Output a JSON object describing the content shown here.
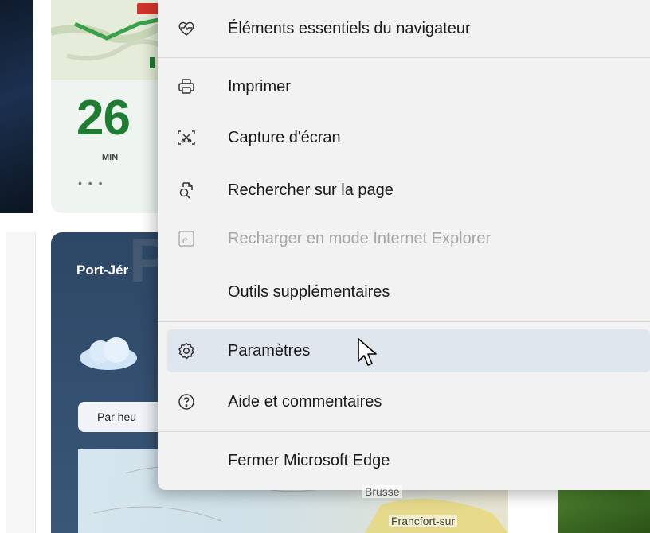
{
  "background": {
    "traffic": {
      "time": "26",
      "unit": "MIN",
      "dots": "• • •"
    },
    "weather": {
      "city": "Port-Jér",
      "period_button": "Par heu",
      "map_labels": {
        "bruxelles": "Brusse",
        "francfort": "Francfort-sur"
      }
    },
    "watermark": "PC ASTUCES"
  },
  "menu": {
    "items": [
      {
        "label": "Éléments essentiels du navigateur",
        "icon": "heart-pulse-icon",
        "enabled": true
      },
      {
        "label": "Imprimer",
        "icon": "printer-icon",
        "enabled": true
      },
      {
        "label": "Capture d'écran",
        "icon": "screenshot-icon",
        "enabled": true
      },
      {
        "label": "Rechercher sur la page",
        "icon": "find-on-page-icon",
        "enabled": true
      },
      {
        "label": "Recharger en mode Internet Explorer",
        "icon": "internet-explorer-icon",
        "enabled": false
      },
      {
        "label": "Outils supplémentaires",
        "icon": "",
        "enabled": true
      },
      {
        "label": "Paramètres",
        "icon": "gear-icon",
        "enabled": true,
        "hovered": true
      },
      {
        "label": "Aide et commentaires",
        "icon": "help-icon",
        "enabled": true
      },
      {
        "label": "Fermer Microsoft Edge",
        "icon": "",
        "enabled": true
      }
    ]
  },
  "colors": {
    "menu_bg": "#f2f2f2",
    "hover_bg": "#e0e6ee",
    "traffic_green": "#1e7d32",
    "weather_card": "#2d4766"
  }
}
